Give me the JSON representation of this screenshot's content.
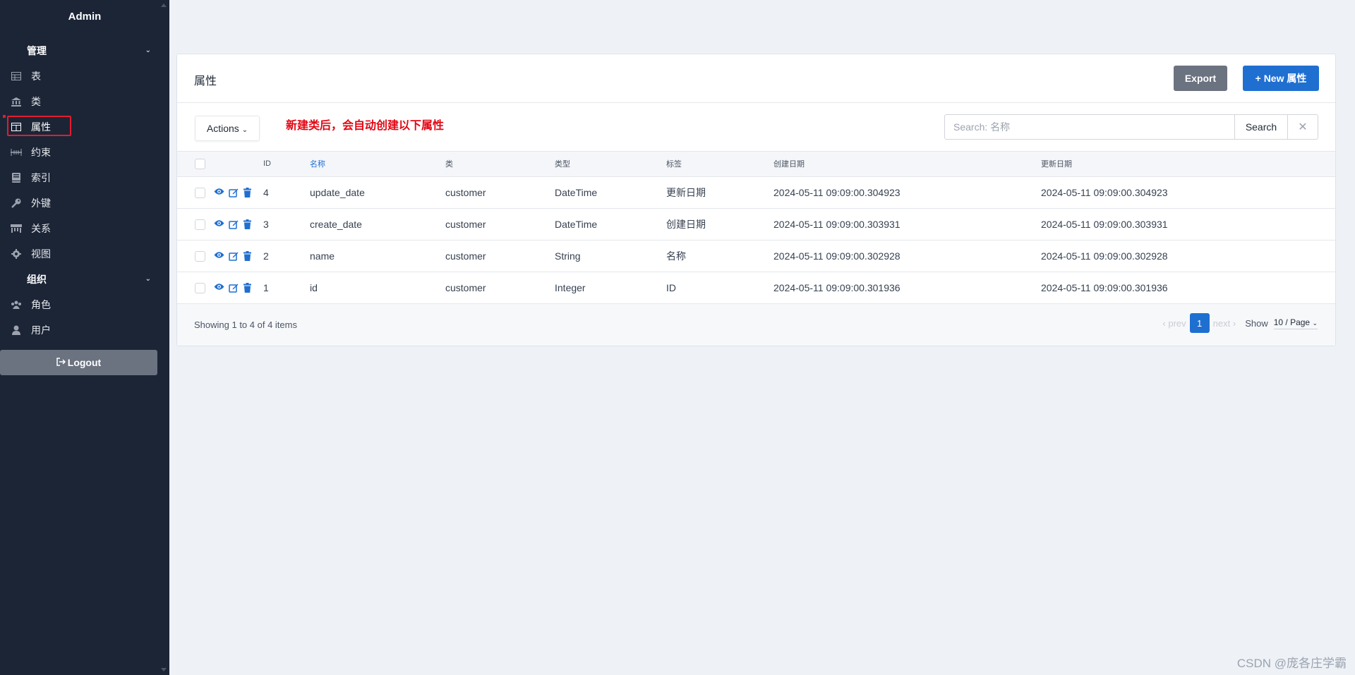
{
  "sidebar": {
    "brand": "Admin",
    "groups": [
      {
        "label": "管理",
        "items": [
          {
            "label": "表",
            "icon": "table-icon"
          },
          {
            "label": "类",
            "icon": "bank-icon"
          },
          {
            "label": "属性",
            "icon": "columns-icon",
            "active": true
          },
          {
            "label": "约束",
            "icon": "ruler-icon"
          },
          {
            "label": "索引",
            "icon": "book-icon"
          },
          {
            "label": "外键",
            "icon": "key-icon"
          },
          {
            "label": "关系",
            "icon": "network-icon"
          },
          {
            "label": "视图",
            "icon": "gear-icon"
          }
        ]
      },
      {
        "label": "组织",
        "items": [
          {
            "label": "角色",
            "icon": "group-icon"
          },
          {
            "label": "用户",
            "icon": "user-icon"
          }
        ]
      }
    ],
    "logout": "Logout"
  },
  "header": {
    "title": "属性",
    "export_label": "Export",
    "new_label": "+ New 属性"
  },
  "toolbar": {
    "actions_label": "Actions",
    "note": "新建类后，会自动创建以下属性",
    "search_placeholder": "Search: 名称",
    "search_label": "Search",
    "clear_label": "✕"
  },
  "table": {
    "columns": [
      "ID",
      "名称",
      "类",
      "类型",
      "标签",
      "创建日期",
      "更新日期"
    ],
    "rows": [
      {
        "id": "4",
        "name": "update_date",
        "cls": "customer",
        "type": "DateTime",
        "label": "更新日期",
        "created": "2024-05-11 09:09:00.304923",
        "updated": "2024-05-11 09:09:00.304923"
      },
      {
        "id": "3",
        "name": "create_date",
        "cls": "customer",
        "type": "DateTime",
        "label": "创建日期",
        "created": "2024-05-11 09:09:00.303931",
        "updated": "2024-05-11 09:09:00.303931"
      },
      {
        "id": "2",
        "name": "name",
        "cls": "customer",
        "type": "String",
        "label": "名称",
        "created": "2024-05-11 09:09:00.302928",
        "updated": "2024-05-11 09:09:00.302928"
      },
      {
        "id": "1",
        "name": "id",
        "cls": "customer",
        "type": "Integer",
        "label": "ID",
        "created": "2024-05-11 09:09:00.301936",
        "updated": "2024-05-11 09:09:00.301936"
      }
    ]
  },
  "footer": {
    "showing": "Showing 1 to 4 of 4 items",
    "prev": "prev",
    "current_page": "1",
    "next": "next",
    "show_label": "Show",
    "page_size": "10 / Page"
  },
  "watermark": "CSDN @庞各庄学霸",
  "colors": {
    "sidebar_bg": "#1b2536",
    "primary": "#1f6fd1",
    "secondary": "#6b7280",
    "note_red": "#e30613"
  }
}
